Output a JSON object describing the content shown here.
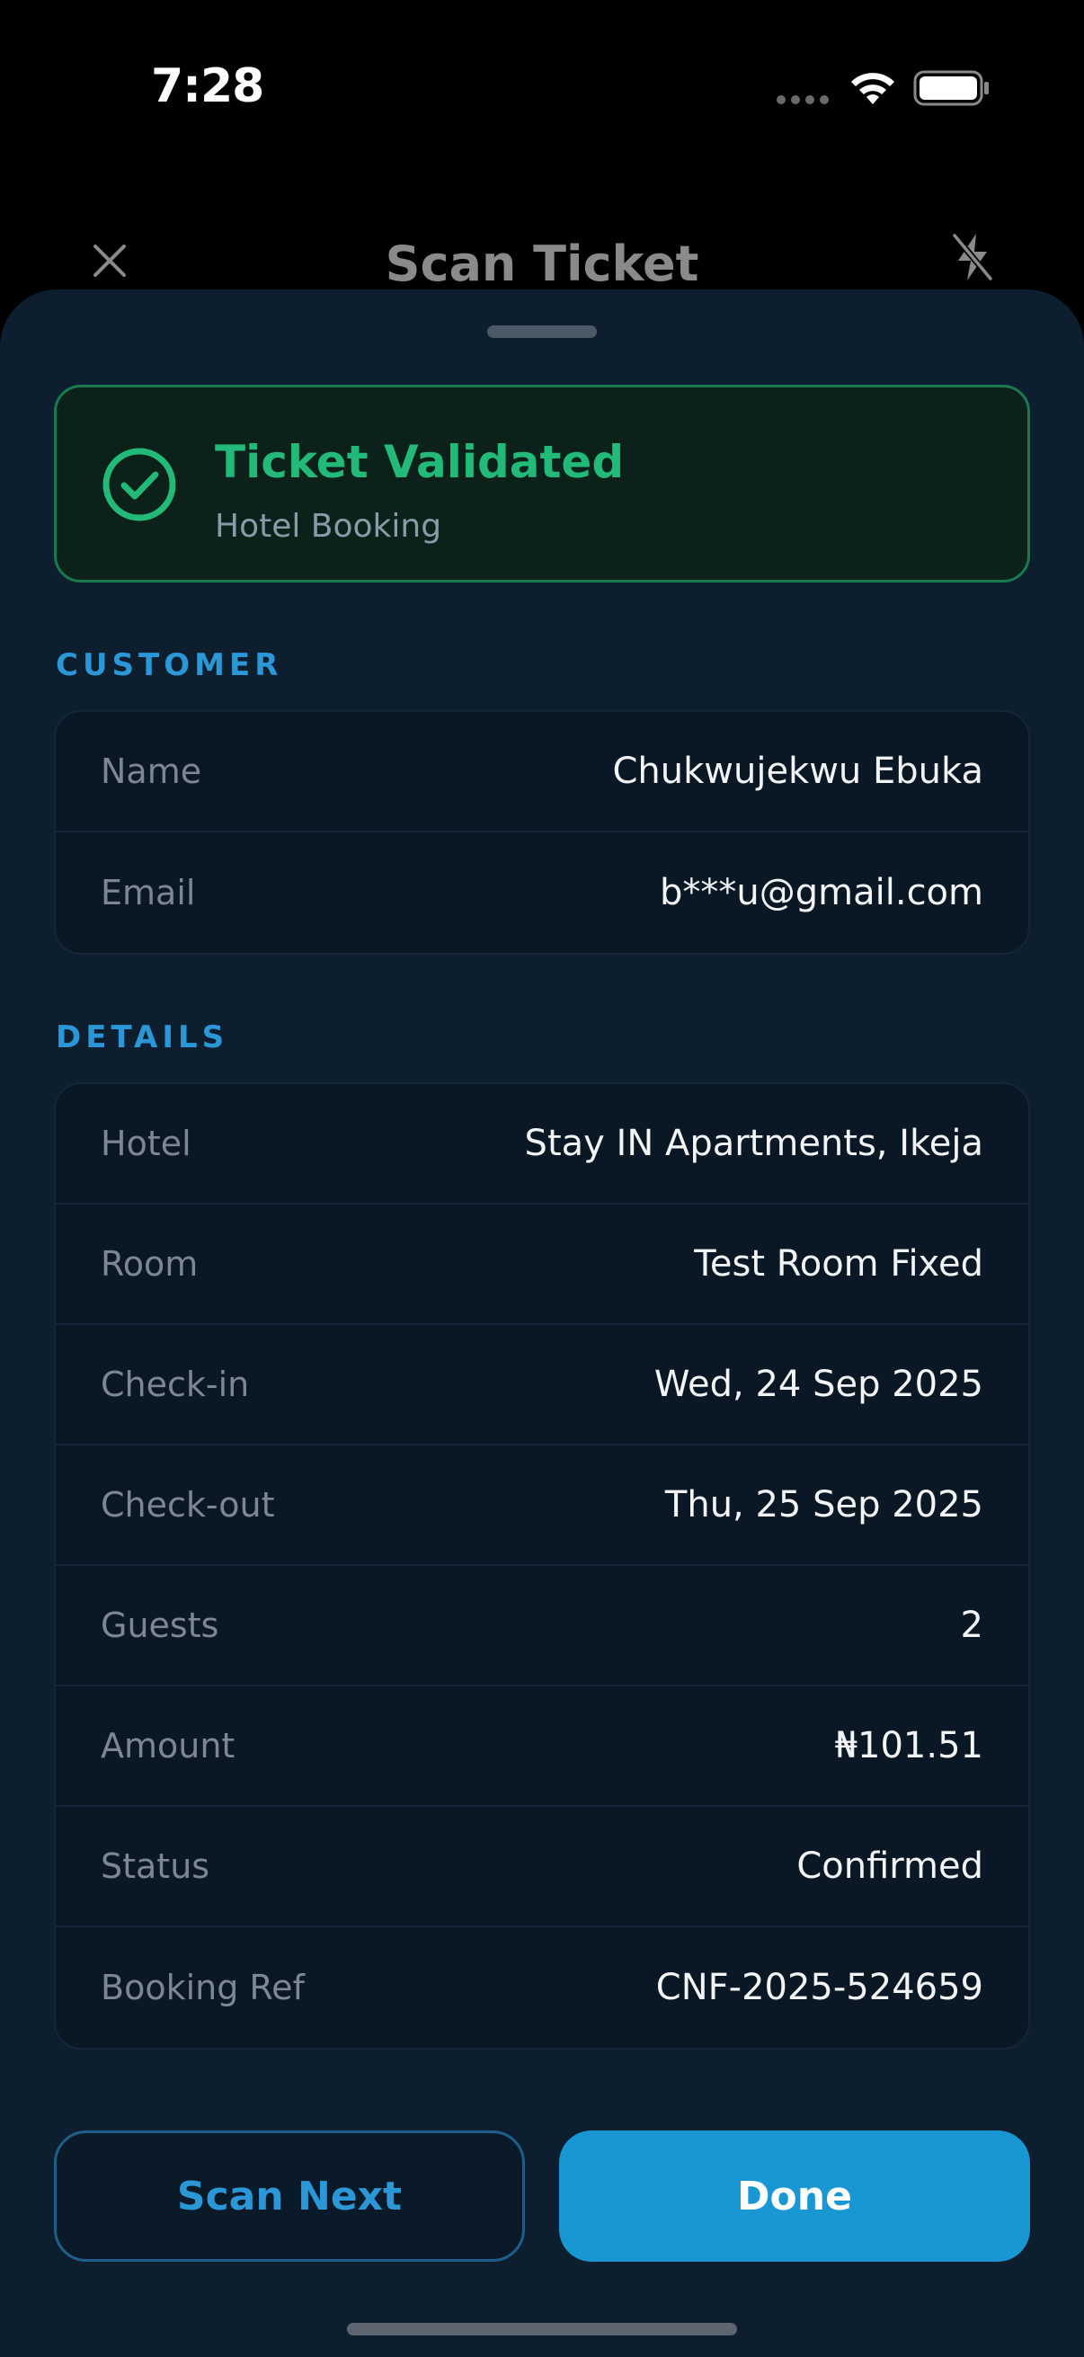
{
  "status_bar": {
    "time": "7:28"
  },
  "header": {
    "title": "Scan Ticket",
    "close_icon": "close-icon",
    "flash_icon": "flash-off-icon"
  },
  "validation": {
    "title": "Ticket Validated",
    "subtitle": "Hotel Booking",
    "icon": "check-circle-icon",
    "color": "#22b979"
  },
  "customer": {
    "label": "CUSTOMER",
    "rows": [
      {
        "key": "Name",
        "value": "Chukwujekwu Ebuka"
      },
      {
        "key": "Email",
        "value": "b***u@gmail.com"
      }
    ]
  },
  "details": {
    "label": "DETAILS",
    "rows": [
      {
        "key": "Hotel",
        "value": "Stay IN Apartments, Ikeja"
      },
      {
        "key": "Room",
        "value": "Test Room Fixed"
      },
      {
        "key": "Check-in",
        "value": "Wed, 24 Sep 2025"
      },
      {
        "key": "Check-out",
        "value": "Thu, 25 Sep 2025"
      },
      {
        "key": "Guests",
        "value": "2"
      },
      {
        "key": "Amount",
        "value": "₦101.51"
      },
      {
        "key": "Status",
        "value": "Confirmed"
      },
      {
        "key": "Booking Ref",
        "value": "CNF-2025-524659"
      }
    ]
  },
  "actions": {
    "scan_next": "Scan Next",
    "done": "Done"
  },
  "colors": {
    "accent": "#2b97d6",
    "primary_button": "#1897d2",
    "success": "#22b979"
  }
}
